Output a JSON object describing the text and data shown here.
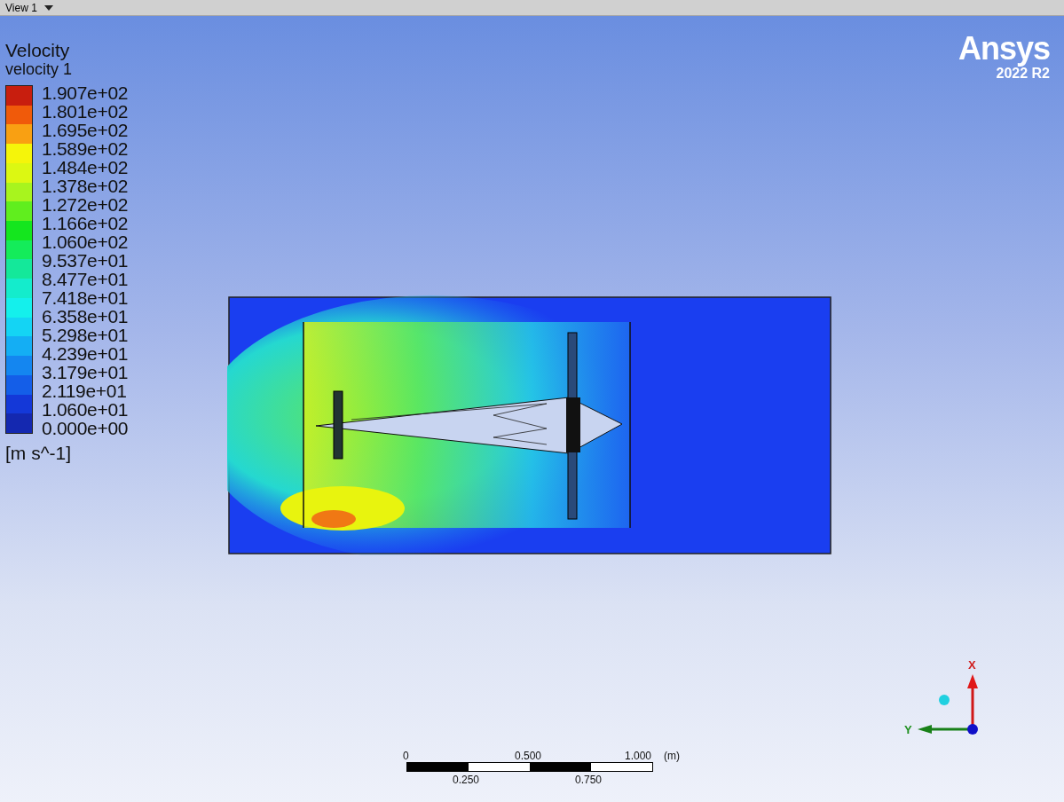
{
  "view_tab": {
    "label": "View 1"
  },
  "legend": {
    "title": "Velocity",
    "variable": "velocity 1",
    "labels": [
      "1.907e+02",
      "1.801e+02",
      "1.695e+02",
      "1.589e+02",
      "1.484e+02",
      "1.378e+02",
      "1.272e+02",
      "1.166e+02",
      "1.060e+02",
      "9.537e+01",
      "8.477e+01",
      "7.418e+01",
      "6.358e+01",
      "5.298e+01",
      "4.239e+01",
      "3.179e+01",
      "2.119e+01",
      "1.060e+01",
      "0.000e+00"
    ],
    "units": "[m s^-1]"
  },
  "logo": {
    "brand": "Ansys",
    "version": "2022 R2"
  },
  "scale_bar": {
    "top_labels": [
      "0",
      "0.500",
      "1.000"
    ],
    "unit": "(m)",
    "bottom_labels": [
      "0.250",
      "0.750"
    ]
  },
  "axis_triad": {
    "x_label": "X",
    "y_label": "Y"
  }
}
